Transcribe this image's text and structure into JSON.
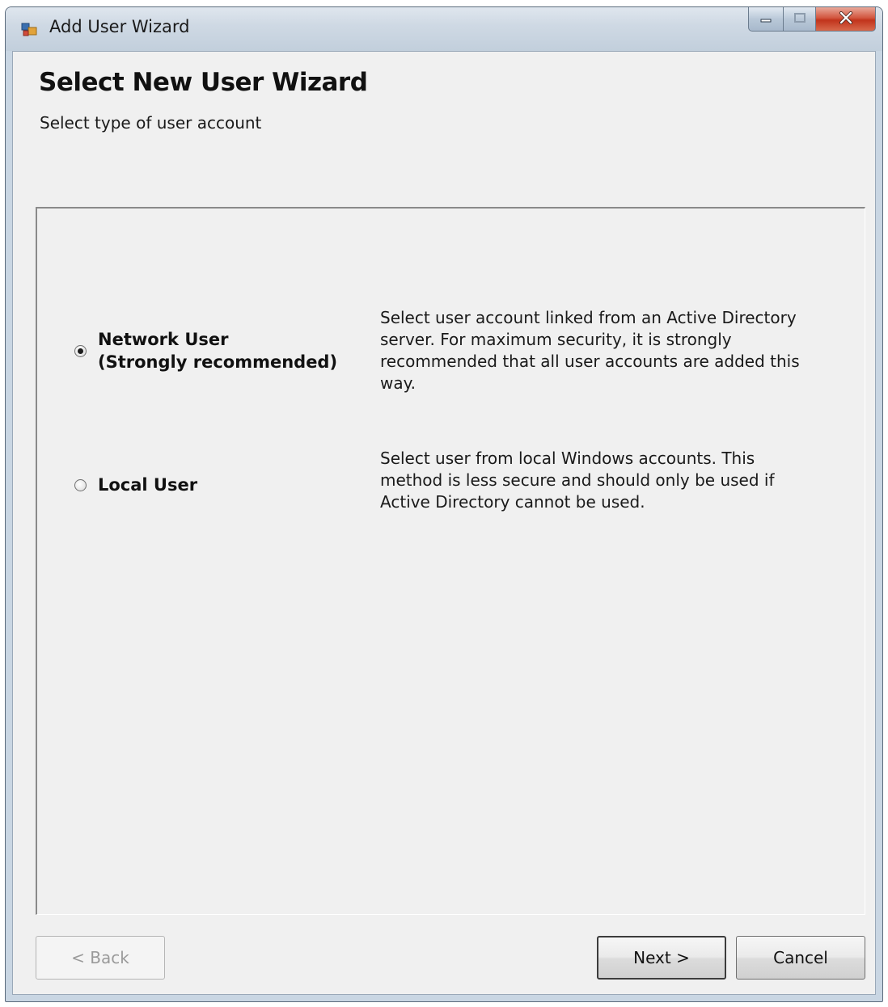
{
  "window": {
    "title": "Add User Wizard"
  },
  "header": {
    "title": "Select New User Wizard",
    "subtitle": "Select type  of user account"
  },
  "options": [
    {
      "label": "Network User\n(Strongly recommended)",
      "description": "Select user account linked from an Active Directory server. For maximum security, it is strongly recommended that all user accounts are added this way.",
      "selected": true
    },
    {
      "label": "Local User",
      "description": "Select user from local Windows accounts. This method is less secure and should only be used if Active Directory cannot be used.",
      "selected": false
    }
  ],
  "footer": {
    "back_label": "< Back",
    "next_label": "Next >",
    "cancel_label": "Cancel",
    "back_enabled": false
  },
  "icons": {
    "app": "app-window-icon",
    "minimize": "minimize-icon",
    "maximize": "maximize-icon",
    "close": "close-icon"
  },
  "colors": {
    "title_bar": "#c9d6e3",
    "close_button": "#c1341c",
    "client_bg": "#f0f0f0"
  }
}
